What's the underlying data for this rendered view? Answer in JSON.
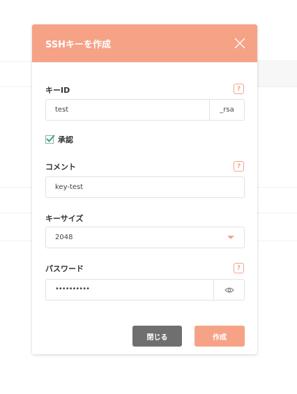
{
  "dialog": {
    "title": "SSHキーを作成",
    "close_icon": "close-x-icon"
  },
  "key_id": {
    "label": "キーID",
    "help": "?",
    "value": "test",
    "suffix": "_rsa"
  },
  "approve": {
    "label": "承認",
    "checked": true
  },
  "comment": {
    "label": "コメント",
    "help": "?",
    "value": "key-test"
  },
  "key_size": {
    "label": "キーサイズ",
    "selected": "2048"
  },
  "password": {
    "label": "パスワード",
    "help": "?",
    "value": "••••••••••",
    "eye_icon": "eye-icon"
  },
  "buttons": {
    "close_label": "閉じる",
    "create_label": "作成"
  },
  "colors": {
    "accent": "#f6a287",
    "secondary_button": "#6f6f6f",
    "check": "#3aa86b"
  }
}
